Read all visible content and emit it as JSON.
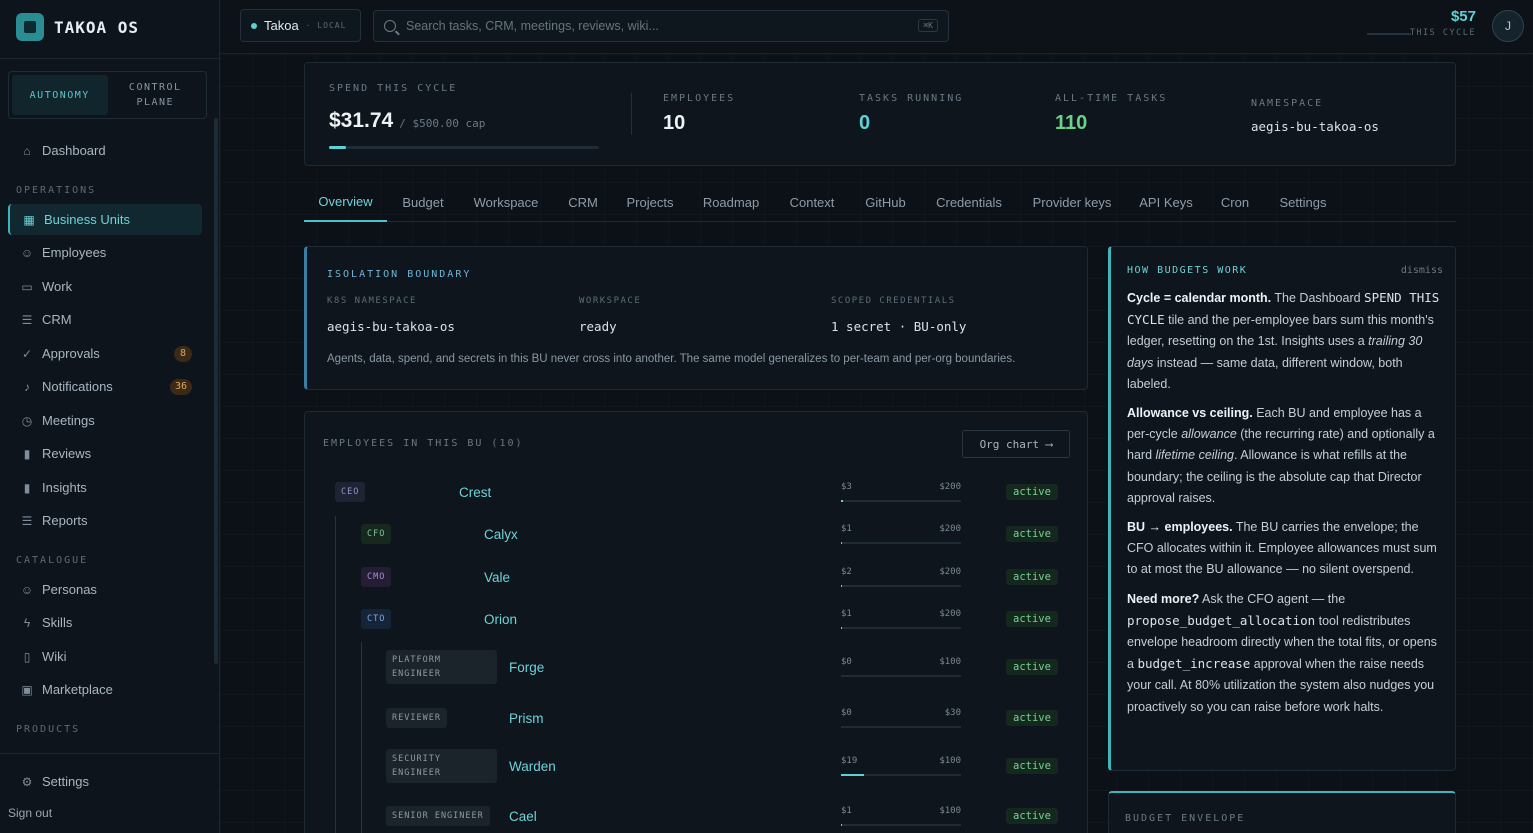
{
  "brand": {
    "name": "TAKOA OS"
  },
  "mode_switch": {
    "autonomy": "AUTONOMY",
    "control_plane_1": "CONTROL",
    "control_plane_2": "PLANE"
  },
  "nav": {
    "dashboard": "Dashboard",
    "operations_label": "OPERATIONS",
    "business_units": "Business Units",
    "employees": "Employees",
    "work": "Work",
    "crm": "CRM",
    "approvals": "Approvals",
    "approvals_count": "8",
    "notifications": "Notifications",
    "notifications_count": "36",
    "meetings": "Meetings",
    "reviews": "Reviews",
    "insights": "Insights",
    "reports": "Reports",
    "catalogue_label": "CATALOGUE",
    "personas": "Personas",
    "skills": "Skills",
    "wiki": "Wiki",
    "marketplace": "Marketplace",
    "products_label": "PRODUCTS",
    "settings": "Settings",
    "sign_out": "Sign out"
  },
  "topbar": {
    "workspace_name": "Takoa",
    "workspace_tag": "· LOCAL",
    "search_placeholder": "Search tasks, CRM, meetings, reviews, wiki...",
    "search_kbd": "⌘K",
    "cycle_value": "$57",
    "cycle_label": "THIS CYCLE",
    "avatar_initial": "J"
  },
  "stats": {
    "spend_label": "SPEND THIS CYCLE",
    "spend_value": "$31.74",
    "spend_cap": "/ $500.00 cap",
    "spend_fraction": 0.0635,
    "employees_label": "EMPLOYEES",
    "employees_value": "10",
    "tasks_running_label": "TASKS RUNNING",
    "tasks_running_value": "0",
    "all_time_label": "ALL-TIME TASKS",
    "all_time_value": "110",
    "namespace_label": "NAMESPACE",
    "namespace_value": "aegis-bu-takoa-os"
  },
  "tabs": [
    "Overview",
    "Budget",
    "Workspace",
    "CRM",
    "Projects",
    "Roadmap",
    "Context",
    "GitHub",
    "Credentials",
    "Provider keys",
    "API Keys",
    "Cron",
    "Settings"
  ],
  "isolation": {
    "title": "ISOLATION BOUNDARY",
    "k8s_label": "K8S NAMESPACE",
    "k8s_value": "aegis-bu-takoa-os",
    "workspace_label": "WORKSPACE",
    "workspace_value": "ready",
    "creds_label": "SCOPED CREDENTIALS",
    "creds_value": "1 secret · BU-only",
    "note": "Agents, data, spend, and secrets in this BU never cross into another. The same model generalizes to per-team and per-org boundaries."
  },
  "employees_panel": {
    "title": "EMPLOYEES IN THIS BU (10)",
    "org_chart_button": "Org chart ⟶",
    "rows": [
      {
        "role_1": "CEO",
        "role_2": "",
        "name": "Crest",
        "spent": "$3",
        "cap": "$200",
        "fraction": 0.015,
        "status": "active",
        "color": "ceo"
      },
      {
        "role_1": "CFO",
        "role_2": "",
        "name": "Calyx",
        "spent": "$1",
        "cap": "$200",
        "fraction": 0.005,
        "status": "active",
        "color": "cfo"
      },
      {
        "role_1": "CMO",
        "role_2": "",
        "name": "Vale",
        "spent": "$2",
        "cap": "$200",
        "fraction": 0.01,
        "status": "active",
        "color": "cmo"
      },
      {
        "role_1": "CTO",
        "role_2": "",
        "name": "Orion",
        "spent": "$1",
        "cap": "$200",
        "fraction": 0.005,
        "status": "active",
        "color": "cto"
      },
      {
        "role_1": "PLATFORM",
        "role_2": "ENGINEER",
        "name": "Forge",
        "spent": "$0",
        "cap": "$100",
        "fraction": 0.0,
        "status": "active",
        "color": "gray"
      },
      {
        "role_1": "REVIEWER",
        "role_2": "",
        "name": "Prism",
        "spent": "$0",
        "cap": "$30",
        "fraction": 0.0,
        "status": "active",
        "color": "gray"
      },
      {
        "role_1": "SECURITY",
        "role_2": "ENGINEER",
        "name": "Warden",
        "spent": "$19",
        "cap": "$100",
        "fraction": 0.19,
        "status": "active",
        "color": "gray"
      },
      {
        "role_1": "SENIOR ENGINEER",
        "role_2": "",
        "name": "Cael",
        "spent": "$1",
        "cap": "$100",
        "fraction": 0.01,
        "status": "active",
        "color": "gray"
      }
    ]
  },
  "how_budgets": {
    "title": "HOW BUDGETS WORK",
    "dismiss": "dismiss",
    "p1_b": "Cycle = calendar month.",
    "p1_t1": " The Dashboard ",
    "p1_c": "SPEND THIS CYCLE",
    "p1_t2": " tile and the per-employee bars sum this month's ledger, resetting on the 1st. Insights uses a ",
    "p1_i": "trailing 30 days",
    "p1_t3": " instead — same data, different window, both labeled.",
    "p2_b": "Allowance vs ceiling.",
    "p2_t1": " Each BU and employee has a per-cycle ",
    "p2_i1": "allowance",
    "p2_t2": " (the recurring rate) and optionally a hard ",
    "p2_i2": "lifetime ceiling",
    "p2_t3": ". Allowance is what refills at the boundary; the ceiling is the absolute cap that Director approval raises.",
    "p3_b": "BU → employees.",
    "p3_t1": " The BU carries the envelope; the CFO allocates within it. Employee allowances must sum to at most the BU allowance — no silent overspend.",
    "p4_b": "Need more?",
    "p4_t1": " Ask the CFO agent — the ",
    "p4_c1": "propose_budget_allocation",
    "p4_t2": " tool redistributes envelope headroom directly when the total fits, or opens a ",
    "p4_c2": "budget_increase",
    "p4_t3": " approval when the raise needs your call. At 80% utilization the system also nudges you proactively so you can raise before work halts."
  },
  "budget_envelope": {
    "title": "BUDGET ENVELOPE"
  }
}
